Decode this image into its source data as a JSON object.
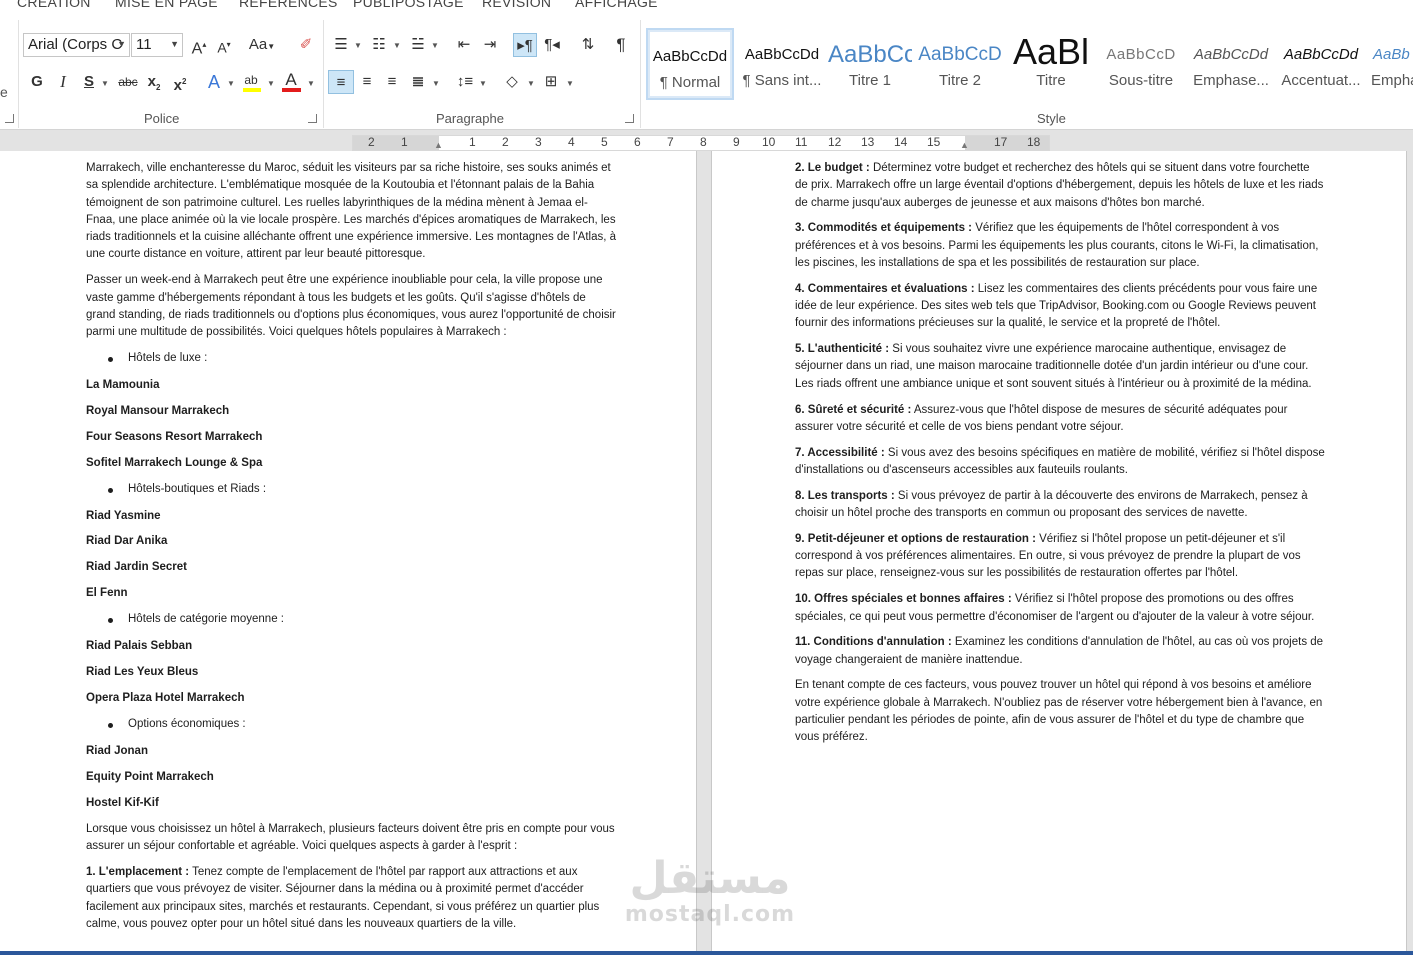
{
  "ribbon": {
    "tabs": [
      "CRÉATION",
      "MISE EN PAGE",
      "RÉFÉRENCES",
      "PUBLIPOSTAGE",
      "RÉVISION",
      "AFFICHAGE"
    ],
    "font_name": "Arial (Corps C",
    "font_size": "11",
    "groups": {
      "police": "Police",
      "paragraphe": "Paragraphe",
      "style": "Style"
    },
    "styles": [
      {
        "sample": "AaBbCcDd",
        "name": "¶ Normal"
      },
      {
        "sample": "AaBbCcDd",
        "name": "¶ Sans int..."
      },
      {
        "sample": "AaBbCc",
        "name": "Titre 1"
      },
      {
        "sample": "AaBbCcD",
        "name": "Titre 2"
      },
      {
        "sample": "AaBl",
        "name": "Titre"
      },
      {
        "sample": "AaBbCcD",
        "name": "Sous-titre"
      },
      {
        "sample": "AaBbCcDd",
        "name": "Emphase..."
      },
      {
        "sample": "AaBbCcDd",
        "name": "Accentuat..."
      },
      {
        "sample": "AaBb",
        "name": "Empha"
      }
    ],
    "colors": {
      "highlight": "#ffff00",
      "font_color": "#e31c1c",
      "accent": "#2b579a"
    }
  },
  "ruler": [
    "2",
    "1",
    "1",
    "2",
    "3",
    "4",
    "5",
    "6",
    "7",
    "8",
    "9",
    "10",
    "11",
    "12",
    "13",
    "14",
    "15",
    "17",
    "18"
  ],
  "left_page": {
    "intro1": "Marrakech, ville enchanteresse du Maroc, séduit les visiteurs par sa riche histoire, ses souks animés et sa splendide architecture. L'emblématique mosquée de la Koutoubia et l'étonnant palais de la Bahia témoignent de son patrimoine culturel. Les ruelles labyrinthiques de la médina mènent à Jemaa el-Fnaa, une place animée où la vie locale prospère. Les marchés d'épices aromatiques de Marrakech, les riads traditionnels et la cuisine alléchante offrent une expérience immersive. Les montagnes de l'Atlas, à une courte distance en voiture, attirent par leur beauté pittoresque.",
    "intro2": "Passer un week-end à Marrakech peut être une expérience inoubliable pour cela, la ville propose une vaste gamme d'hébergements répondant à tous les budgets et les goûts. Qu'il s'agisse d'hôtels de grand standing, de riads traditionnels ou d'options plus économiques, vous aurez l'opportunité de choisir parmi une multitude de possibilités. Voici quelques hôtels populaires à Marrakech :",
    "cat1": "Hôtels de luxe :",
    "cat1_items": [
      "La Mamounia",
      "Royal Mansour Marrakech",
      "Four Seasons Resort Marrakech",
      "Sofitel Marrakech Lounge & Spa"
    ],
    "cat2": "Hôtels-boutiques et Riads :",
    "cat2_items": [
      "Riad Yasmine",
      "Riad Dar Anika",
      "Riad Jardin Secret",
      "El Fenn"
    ],
    "cat3": "Hôtels de catégorie moyenne :",
    "cat3_items": [
      "Riad Palais Sebban",
      "Riad Les Yeux Bleus",
      "Opera Plaza Hotel Marrakech"
    ],
    "cat4": "Options économiques :",
    "cat4_items": [
      "Riad Jonan",
      "Equity Point Marrakech",
      "Hostel Kif-Kif"
    ],
    "factors_intro": "Lorsque vous choisissez un hôtel à Marrakech, plusieurs facteurs doivent être pris en compte pour vous assurer un séjour confortable et agréable. Voici quelques aspects à garder à l'esprit :",
    "f1_title": "1. L'emplacement :",
    "f1_text": " Tenez compte de l'emplacement de l'hôtel par rapport aux attractions et aux quartiers que vous prévoyez de visiter. Séjourner dans la médina ou à proximité permet d'accéder facilement aux principaux sites, marchés et restaurants. Cependant, si vous préférez un quartier plus calme, vous pouvez opter pour un hôtel situé dans les nouveaux quartiers de la ville."
  },
  "right_page": {
    "factors": [
      {
        "title": "2. Le budget :",
        "text": " Déterminez votre budget et recherchez des hôtels qui se situent dans votre fourchette de prix. Marrakech offre un large éventail d'options d'hébergement, depuis les hôtels de luxe et les riads de charme jusqu'aux auberges de jeunesse et aux maisons d'hôtes bon marché."
      },
      {
        "title": "3. Commodités et équipements :",
        "text": " Vérifiez que les équipements de l'hôtel correspondent à vos préférences et à vos besoins. Parmi les équipements les plus courants, citons le Wi-Fi, la climatisation, les piscines, les installations de spa et les possibilités de restauration sur place."
      },
      {
        "title": "4. Commentaires et évaluations :",
        "text": " Lisez les commentaires des clients précédents pour vous faire une idée de leur expérience. Des sites web tels que TripAdvisor, Booking.com ou Google Reviews peuvent fournir des informations précieuses sur la qualité, le service et la propreté de l'hôtel."
      },
      {
        "title": "5. L'authenticité :",
        "text": " Si vous souhaitez vivre une expérience marocaine authentique, envisagez de séjourner dans un riad, une maison marocaine traditionnelle dotée d'un jardin intérieur ou d'une cour. Les riads offrent une ambiance unique et sont souvent situés à l'intérieur ou à proximité de la médina."
      },
      {
        "title": "6. Sûreté et sécurité :",
        "text": " Assurez-vous que l'hôtel dispose de mesures de sécurité adéquates pour assurer votre sécurité et celle de vos biens pendant votre séjour."
      },
      {
        "title": "7. Accessibilité :",
        "text": " Si vous avez des besoins spécifiques en matière de mobilité, vérifiez si l'hôtel dispose d'installations ou d'ascenseurs accessibles aux fauteuils roulants."
      },
      {
        "title": "8. Les transports :",
        "text": " Si vous prévoyez de partir à la découverte des environs de Marrakech, pensez à choisir un hôtel proche des transports en commun ou proposant des services de navette."
      },
      {
        "title": "9. Petit-déjeuner et options de restauration :",
        "text": " Vérifiez si l'hôtel propose un petit-déjeuner et s'il correspond à vos préférences alimentaires. En outre, si vous prévoyez de prendre la plupart de vos repas sur place, renseignez-vous sur les possibilités de restauration offertes par l'hôtel."
      },
      {
        "title": "10. Offres spéciales et bonnes affaires :",
        "text": " Vérifiez si l'hôtel propose des promotions ou des offres spéciales, ce qui peut vous permettre d'économiser de l'argent ou d'ajouter de la valeur à votre séjour."
      },
      {
        "title": "11. Conditions d'annulation :",
        "text": " Examinez les conditions d'annulation de l'hôtel, au cas où vos projets de voyage changeraient de manière inattendue."
      }
    ],
    "conclusion": "En tenant compte de ces facteurs, vous pouvez trouver un hôtel qui répond à vos besoins et améliore votre expérience globale à Marrakech. N'oubliez pas de réserver votre hébergement bien à l'avance, en particulier pendant les périodes de pointe, afin de vous assurer de l'hôtel et du type de chambre que vous préférez."
  },
  "watermark": {
    "arabic": "مستقل",
    "latin": "mostaql.com"
  }
}
